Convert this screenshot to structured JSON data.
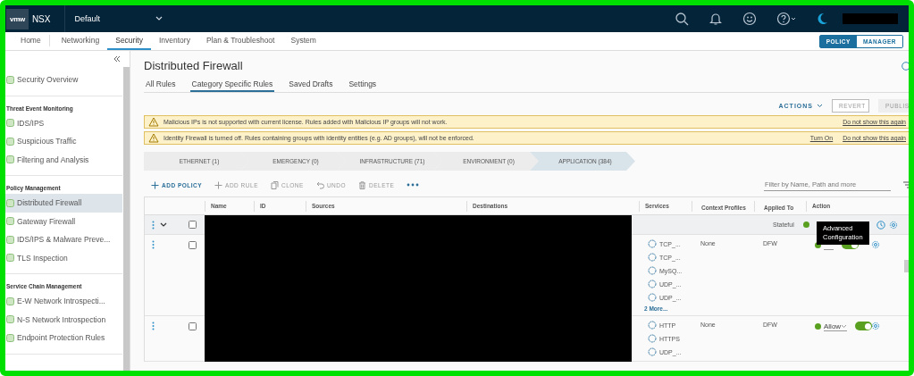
{
  "header": {
    "logo": "vmw",
    "product": "NSX",
    "project": "Default"
  },
  "nav": {
    "tabs": [
      {
        "label": "Home",
        "selected": false
      },
      {
        "label": "Networking",
        "selected": false
      },
      {
        "label": "Security",
        "selected": true
      },
      {
        "label": "Inventory",
        "selected": false
      },
      {
        "label": "Plan & Troubleshoot",
        "selected": false
      },
      {
        "label": "System",
        "selected": false
      }
    ],
    "modes": [
      {
        "label": "POLICY",
        "selected": true
      },
      {
        "label": "MANAGER",
        "selected": false
      }
    ]
  },
  "sidebar": {
    "groups": [
      {
        "items": [
          {
            "label": "Security Overview",
            "selected": false
          }
        ]
      },
      {
        "heading": "Threat Event Monitoring",
        "items": [
          {
            "label": "IDS/IPS",
            "selected": false
          },
          {
            "label": "Suspicious Traffic",
            "selected": false
          },
          {
            "label": "Filtering and Analysis",
            "selected": false
          }
        ]
      },
      {
        "heading": "Policy Management",
        "items": [
          {
            "label": "Distributed Firewall",
            "selected": true
          },
          {
            "label": "Gateway Firewall",
            "selected": false
          },
          {
            "label": "IDS/IPS & Malware Preve...",
            "selected": false
          },
          {
            "label": "TLS Inspection",
            "selected": false
          }
        ]
      },
      {
        "heading": "Service Chain Management",
        "items": [
          {
            "label": "E-W Network Introspecti...",
            "selected": false
          },
          {
            "label": "N-S Network Introspection",
            "selected": false
          },
          {
            "label": "Endpoint Protection Rules",
            "selected": false
          }
        ]
      }
    ]
  },
  "page": {
    "title": "Distributed Firewall",
    "tabs": [
      {
        "label": "All Rules",
        "selected": false
      },
      {
        "label": "Category Specific Rules",
        "selected": true
      },
      {
        "label": "Saved Drafts",
        "selected": false
      },
      {
        "label": "Settings",
        "selected": false
      }
    ],
    "actions": {
      "menu": "ACTIONS",
      "buttons": [
        {
          "label": "REVERT",
          "disabled": true
        },
        {
          "label": "PUBLIS",
          "disabled": true
        }
      ]
    },
    "alerts": [
      {
        "text": "Malicious IPs is not supported with current license. Rules added with Malicious IP groups will not work.",
        "links": [
          "Do not show this again"
        ]
      },
      {
        "text": "Identity Firewall is turned off. Rules containing groups with identity entities (e.g. AD groups), will not be enforced.",
        "links": [
          "Turn On",
          "Do not show this again"
        ]
      }
    ],
    "categories": [
      {
        "label": "ETHERNET (1)",
        "selected": false
      },
      {
        "label": "EMERGENCY (0)",
        "selected": false
      },
      {
        "label": "INFRASTRUCTURE (71)",
        "selected": false
      },
      {
        "label": "ENVIRONMENT (0)",
        "selected": false
      },
      {
        "label": "APPLICATION (384)",
        "selected": true
      }
    ],
    "toolbar": [
      {
        "kind": "add",
        "label": "ADD POLICY",
        "disabled": false
      },
      {
        "kind": "add",
        "label": "ADD RULE",
        "disabled": true
      },
      {
        "kind": "clone",
        "label": "CLONE",
        "disabled": true
      },
      {
        "kind": "undo",
        "label": "UNDO",
        "disabled": true
      },
      {
        "kind": "delete",
        "label": "DELETE",
        "disabled": true
      },
      {
        "kind": "more"
      }
    ],
    "filter": {
      "placeholder": "Filter by Name, Path and more"
    },
    "table": {
      "columns": [
        "Name",
        "ID",
        "Sources",
        "Destinations",
        "Services",
        "Context Profiles",
        "Applied To",
        "Action"
      ],
      "rows": [
        {
          "kind": "policy",
          "expanded": true,
          "checked": false,
          "type": "Stateful"
        },
        {
          "kind": "rule",
          "checked": false,
          "services": [
            "TCP_...",
            "TCP_...",
            "MySQ...",
            "UDP_...",
            "UDP_..."
          ],
          "more": "2 More...",
          "context": "None",
          "applied_to": "DFW",
          "enabled": true
        },
        {
          "kind": "rule",
          "checked": false,
          "services": [
            "HTTP",
            "HTTPS",
            "UDP_..."
          ],
          "context": "None",
          "applied_to": "DFW",
          "action": "Allow",
          "enabled": true
        }
      ]
    },
    "tooltip": {
      "lines": [
        "Advanced",
        "Configuration"
      ]
    }
  }
}
